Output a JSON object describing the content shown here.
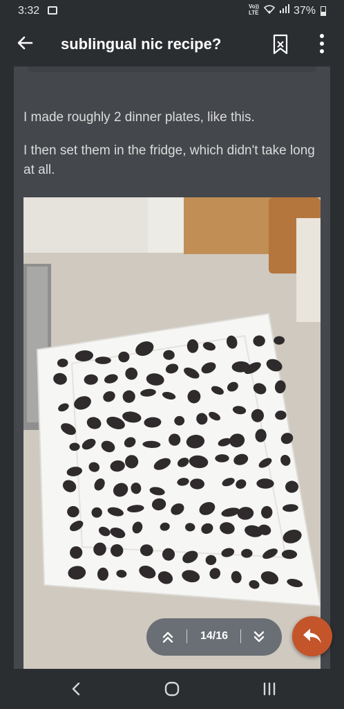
{
  "status_bar": {
    "time": "3:32",
    "network_label": "Vo)) LTE",
    "battery": "37%"
  },
  "app_bar": {
    "title": "sublingual nic recipe?",
    "icons": [
      "back-arrow-icon",
      "bookmark-icon",
      "more-vert-icon"
    ]
  },
  "post": {
    "paragraphs": [
      "I made roughly 2 dinner plates, like this.",
      "I then set them in the fridge, which didn't take long at all."
    ],
    "image_icon": "photo-of-plate-with-dark-drops"
  },
  "pager": {
    "position": "14/16",
    "icons": [
      "double-chevron-up-icon",
      "double-chevron-down-icon"
    ]
  },
  "fab": {
    "icon": "reply-icon",
    "color": "#c4542a"
  },
  "system_nav": {
    "icons": [
      "nav-back-icon",
      "nav-home-icon",
      "nav-recent-icon"
    ]
  },
  "colors": {
    "background": "#2b2e31",
    "card": "#44474b",
    "text": "#dcdcdc",
    "accent": "#c4542a"
  }
}
